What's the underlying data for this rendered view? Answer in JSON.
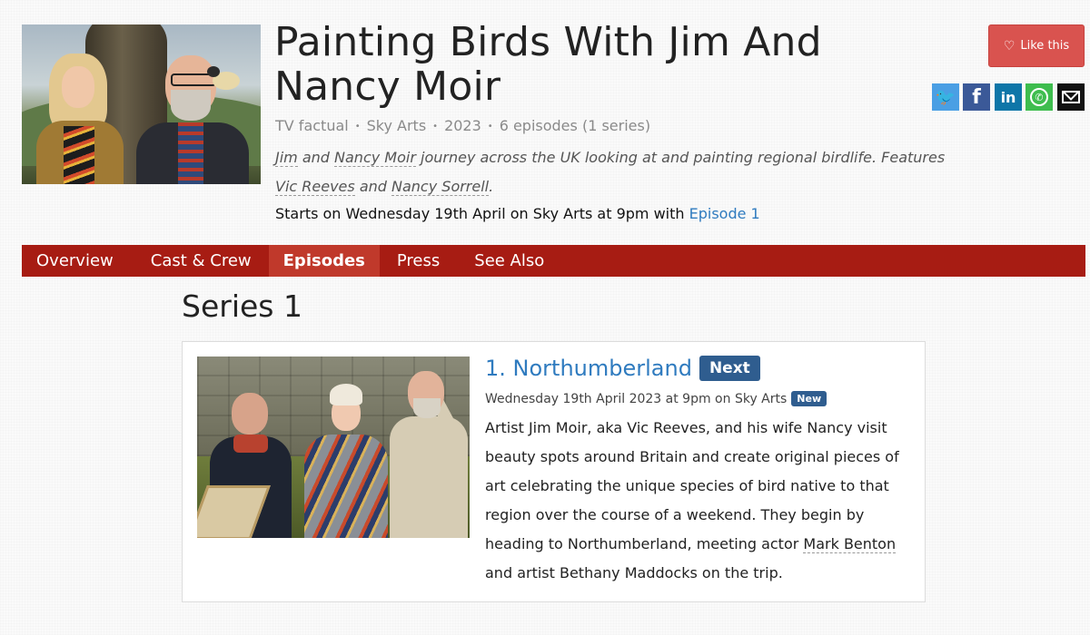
{
  "show": {
    "title": "Painting Birds With Jim And Nancy Moir",
    "genre": "TV factual",
    "channel": "Sky Arts",
    "year": "2023",
    "episodes_count": "6 episodes (1 series)",
    "synopsis": {
      "names1": "Jim",
      "and1": " and ",
      "names2": "Nancy Moir",
      "text1": " journey across the UK looking at and painting regional birdlife. Features ",
      "names3": "Vic Reeves",
      "and2": " and ",
      "names4": "Nancy Sorrell",
      "end": "."
    },
    "starts": {
      "prefix": "Starts on Wednesday 19th April on Sky Arts at 9pm with ",
      "episode_link": "Episode 1"
    }
  },
  "actions": {
    "like_label": "Like this",
    "share": [
      "twitter-icon",
      "facebook-icon",
      "linkedin-icon",
      "whatsapp-icon",
      "email-icon"
    ],
    "share_glyphs": {
      "twitter": "🐦",
      "facebook": "f",
      "linkedin": "in",
      "whatsapp": "✆"
    }
  },
  "tabs": [
    {
      "label": "Overview",
      "active": false
    },
    {
      "label": "Cast & Crew",
      "active": false
    },
    {
      "label": "Episodes",
      "active": true
    },
    {
      "label": "Press",
      "active": false
    },
    {
      "label": "See Also",
      "active": false
    }
  ],
  "series": {
    "title": "Series 1",
    "episodes": [
      {
        "title": "1. Northumberland",
        "next_badge": "Next",
        "air_info": "Wednesday 19th April 2023 at 9pm on Sky Arts",
        "new_badge": "New",
        "desc_before": "Artist Jim Moir, aka Vic Reeves, and his wife Nancy visit beauty spots around Britain and create original pieces of art celebrating the unique species of bird native to that region over the course of a weekend. They begin by heading to Northumberland, meeting actor ",
        "desc_link1": "Mark Benton",
        "desc_mid": " and artist ",
        "desc_link2": "Bethany Maddocks",
        "desc_after": " on the trip."
      }
    ]
  },
  "colors": {
    "nav_bg": "#a71c13",
    "nav_active": "#c0392b",
    "like_bg": "#d9534f",
    "link": "#2f7bbf",
    "badge": "#2f5d8f"
  }
}
